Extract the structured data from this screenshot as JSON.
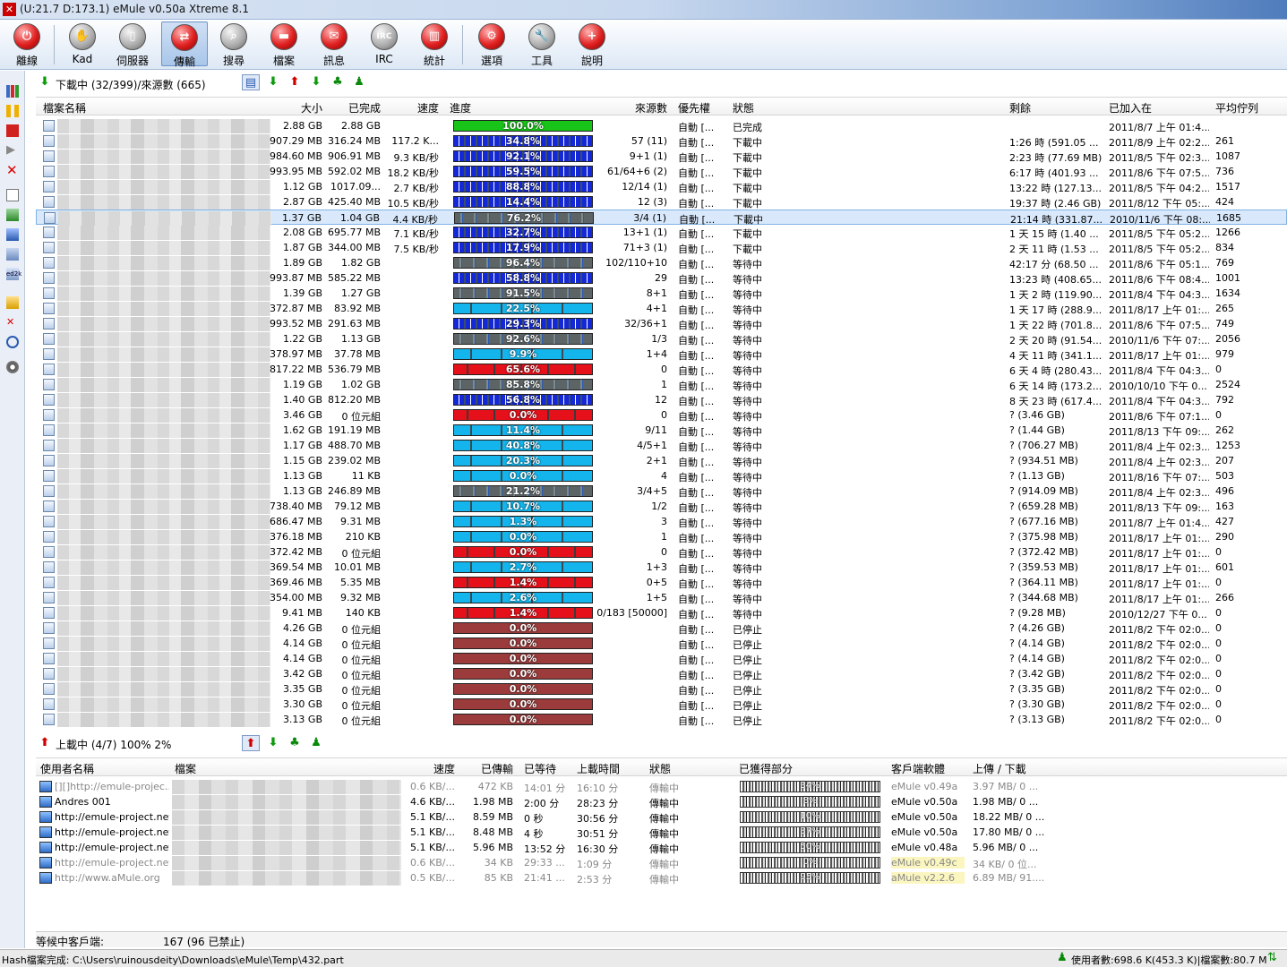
{
  "window": {
    "title": "(U:21.7 D:173.1) eMule v0.50a Xtreme 8.1"
  },
  "toolbar": [
    {
      "label": "離線",
      "icon": "disconnect-icon"
    },
    {
      "label": "Kad",
      "icon": "kad-icon"
    },
    {
      "label": "伺服器",
      "icon": "server-icon"
    },
    {
      "label": "傳輸",
      "icon": "transfer-icon"
    },
    {
      "label": "搜尋",
      "icon": "search-icon"
    },
    {
      "label": "檔案",
      "icon": "shared-files-icon"
    },
    {
      "label": "訊息",
      "icon": "messages-icon"
    },
    {
      "label": "IRC",
      "icon": "irc-icon"
    },
    {
      "label": "統計",
      "icon": "statistics-icon"
    },
    {
      "label": "選項",
      "icon": "options-icon"
    },
    {
      "label": "工具",
      "icon": "tools-icon"
    },
    {
      "label": "說明",
      "icon": "help-icon"
    }
  ],
  "downloads": {
    "title": "下載中 (32/399)/來源數 (665)",
    "columns": [
      "檔案名稱",
      "大小",
      "已完成",
      "速度",
      "進度",
      "來源數",
      "優先權",
      "狀態",
      "剩餘",
      "已加入在",
      "平均佇列"
    ],
    "colors": {
      "blue": "#1428d8",
      "cyan": "#13b5ec",
      "gray": "#5c6466",
      "red": "#e6101a",
      "stopped": "#9c3b3b",
      "green": "#18c418"
    },
    "rows": [
      {
        "size": "2.88 GB",
        "done": "2.88 GB",
        "speed": "",
        "progress": "100.0%",
        "pct": 100,
        "bar": "green",
        "sources": "",
        "priority": "自動 [...",
        "status": "已完成",
        "remaining": "",
        "added": "2011/8/7 上午 01:4...",
        "queue": ""
      },
      {
        "size": "907.29 MB",
        "done": "316.24 MB",
        "speed": "117.2 K...",
        "progress": "34.8%",
        "pct": 34.8,
        "bar": "blue",
        "sources": "57 (11)",
        "priority": "自動 [...",
        "status": "下載中",
        "remaining": "1:26 時 (591.05 ...",
        "added": "2011/8/9 上午 02:2...",
        "queue": "261"
      },
      {
        "size": "984.60 MB",
        "done": "906.91 MB",
        "speed": "9.3 KB/秒",
        "progress": "92.1%",
        "pct": 92.1,
        "bar": "blue",
        "sources": "9+1 (1)",
        "priority": "自動 [...",
        "status": "下載中",
        "remaining": "2:23 時 (77.69 MB)",
        "added": "2011/8/5 下午 02:3...",
        "queue": "1087"
      },
      {
        "size": "993.95 MB",
        "done": "592.02 MB",
        "speed": "18.2 KB/秒",
        "progress": "59.5%",
        "pct": 59.5,
        "bar": "blue",
        "sources": "61/64+6 (2)",
        "priority": "自動 [...",
        "status": "下載中",
        "remaining": "6:17 時 (401.93 ...",
        "added": "2011/8/6 下午 07:5...",
        "queue": "736"
      },
      {
        "size": "1.12 GB",
        "done": "1017.09...",
        "speed": "2.7 KB/秒",
        "progress": "88.8%",
        "pct": 88.8,
        "bar": "blue",
        "sources": "12/14 (1)",
        "priority": "自動 [...",
        "status": "下載中",
        "remaining": "13:22 時 (127.13...",
        "added": "2011/8/5 下午 04:2...",
        "queue": "1517"
      },
      {
        "size": "2.87 GB",
        "done": "425.40 MB",
        "speed": "10.5 KB/秒",
        "progress": "14.4%",
        "pct": 14.4,
        "bar": "blue",
        "sources": "12 (3)",
        "priority": "自動 [...",
        "status": "下載中",
        "remaining": "19:37 時 (2.46 GB)",
        "added": "2011/8/12 下午 05:...",
        "queue": "424"
      },
      {
        "size": "1.37 GB",
        "done": "1.04 GB",
        "speed": "4.4 KB/秒",
        "progress": "76.2%",
        "pct": 76.2,
        "bar": "gray",
        "sources": "3/4 (1)",
        "priority": "自動 [...",
        "status": "下載中",
        "remaining": "21:14 時 (331.87...",
        "added": "2010/11/6 下午 08:...",
        "queue": "1685",
        "selected": true
      },
      {
        "size": "2.08 GB",
        "done": "695.77 MB",
        "speed": "7.1 KB/秒",
        "progress": "32.7%",
        "pct": 32.7,
        "bar": "blue",
        "sources": "13+1 (1)",
        "priority": "自動 [...",
        "status": "下載中",
        "remaining": "1 天 15 時 (1.40 ...",
        "added": "2011/8/5 下午 05:2...",
        "queue": "1266"
      },
      {
        "size": "1.87 GB",
        "done": "344.00 MB",
        "speed": "7.5 KB/秒",
        "progress": "17.9%",
        "pct": 17.9,
        "bar": "blue",
        "sources": "71+3 (1)",
        "priority": "自動 [...",
        "status": "下載中",
        "remaining": "2 天 11 時 (1.53 ...",
        "added": "2011/8/5 下午 05:2...",
        "queue": "834"
      },
      {
        "size": "1.89 GB",
        "done": "1.82 GB",
        "speed": "",
        "progress": "96.4%",
        "pct": 96.4,
        "bar": "gray",
        "sources": "102/110+10",
        "priority": "自動 [...",
        "status": "等待中",
        "remaining": "42:17 分 (68.50 ...",
        "added": "2011/8/6 下午 05:1...",
        "queue": "769"
      },
      {
        "size": "993.87 MB",
        "done": "585.22 MB",
        "speed": "",
        "progress": "58.8%",
        "pct": 58.8,
        "bar": "blue",
        "sources": "29",
        "priority": "自動 [...",
        "status": "等待中",
        "remaining": "13:23 時 (408.65...",
        "added": "2011/8/6 下午 08:4...",
        "queue": "1001"
      },
      {
        "size": "1.39 GB",
        "done": "1.27 GB",
        "speed": "",
        "progress": "91.5%",
        "pct": 91.5,
        "bar": "gray",
        "sources": "8+1",
        "priority": "自動 [...",
        "status": "等待中",
        "remaining": "1 天 2 時 (119.90...",
        "added": "2011/8/4 下午 04:3...",
        "queue": "1634"
      },
      {
        "size": "372.87 MB",
        "done": "83.92 MB",
        "speed": "",
        "progress": "22.5%",
        "pct": 22.5,
        "bar": "cyan",
        "sources": "4+1",
        "priority": "自動 [...",
        "status": "等待中",
        "remaining": "1 天 17 時 (288.9...",
        "added": "2011/8/17 上午 01:...",
        "queue": "265"
      },
      {
        "size": "993.52 MB",
        "done": "291.63 MB",
        "speed": "",
        "progress": "29.3%",
        "pct": 29.3,
        "bar": "blue",
        "sources": "32/36+1",
        "priority": "自動 [...",
        "status": "等待中",
        "remaining": "1 天 22 時 (701.8...",
        "added": "2011/8/6 下午 07:5...",
        "queue": "749"
      },
      {
        "size": "1.22 GB",
        "done": "1.13 GB",
        "speed": "",
        "progress": "92.6%",
        "pct": 92.6,
        "bar": "gray",
        "sources": "1/3",
        "priority": "自動 [...",
        "status": "等待中",
        "remaining": "2 天 20 時 (91.54...",
        "added": "2010/11/6 下午 07:...",
        "queue": "2056"
      },
      {
        "size": "378.97 MB",
        "done": "37.78 MB",
        "speed": "",
        "progress": "9.9%",
        "pct": 9.9,
        "bar": "cyan",
        "sources": "1+4",
        "priority": "自動 [...",
        "status": "等待中",
        "remaining": "4 天 11 時 (341.1...",
        "added": "2011/8/17 上午 01:...",
        "queue": "979"
      },
      {
        "size": "817.22 MB",
        "done": "536.79 MB",
        "speed": "",
        "progress": "65.6%",
        "pct": 65.6,
        "bar": "red",
        "sources": "0",
        "priority": "自動 [...",
        "status": "等待中",
        "remaining": "6 天 4 時 (280.43...",
        "added": "2011/8/4 下午 04:3...",
        "queue": "0"
      },
      {
        "size": "1.19 GB",
        "done": "1.02 GB",
        "speed": "",
        "progress": "85.8%",
        "pct": 85.8,
        "bar": "gray",
        "sources": "1",
        "priority": "自動 [...",
        "status": "等待中",
        "remaining": "6 天 14 時 (173.2...",
        "added": "2010/10/10 下午 0...",
        "queue": "2524"
      },
      {
        "size": "1.40 GB",
        "done": "812.20 MB",
        "speed": "",
        "progress": "56.8%",
        "pct": 56.8,
        "bar": "blue",
        "sources": "12",
        "priority": "自動 [...",
        "status": "等待中",
        "remaining": "8 天 23 時 (617.4...",
        "added": "2011/8/4 下午 04:3...",
        "queue": "792"
      },
      {
        "size": "3.46 GB",
        "done": "0 位元組",
        "speed": "",
        "progress": "0.0%",
        "pct": 0,
        "bar": "red",
        "sources": "0",
        "priority": "自動 [...",
        "status": "等待中",
        "remaining": "? (3.46 GB)",
        "added": "2011/8/6 下午 07:1...",
        "queue": "0"
      },
      {
        "size": "1.62 GB",
        "done": "191.19 MB",
        "speed": "",
        "progress": "11.4%",
        "pct": 11.4,
        "bar": "cyan",
        "sources": "9/11",
        "priority": "自動 [...",
        "status": "等待中",
        "remaining": "? (1.44 GB)",
        "added": "2011/8/13 下午 09:...",
        "queue": "262"
      },
      {
        "size": "1.17 GB",
        "done": "488.70 MB",
        "speed": "",
        "progress": "40.8%",
        "pct": 40.8,
        "bar": "cyan",
        "sources": "4/5+1",
        "priority": "自動 [...",
        "status": "等待中",
        "remaining": "? (706.27 MB)",
        "added": "2011/8/4 上午 02:3...",
        "queue": "1253"
      },
      {
        "size": "1.15 GB",
        "done": "239.02 MB",
        "speed": "",
        "progress": "20.3%",
        "pct": 20.3,
        "bar": "cyan",
        "sources": "2+1",
        "priority": "自動 [...",
        "status": "等待中",
        "remaining": "? (934.51 MB)",
        "added": "2011/8/4 上午 02:3...",
        "queue": "207"
      },
      {
        "size": "1.13 GB",
        "done": "11 KB",
        "speed": "",
        "progress": "0.0%",
        "pct": 0,
        "bar": "cyan",
        "sources": "4",
        "priority": "自動 [...",
        "status": "等待中",
        "remaining": "? (1.13 GB)",
        "added": "2011/8/16 下午 07:...",
        "queue": "503"
      },
      {
        "size": "1.13 GB",
        "done": "246.89 MB",
        "speed": "",
        "progress": "21.2%",
        "pct": 21.2,
        "bar": "gray",
        "sources": "3/4+5",
        "priority": "自動 [...",
        "status": "等待中",
        "remaining": "? (914.09 MB)",
        "added": "2011/8/4 上午 02:3...",
        "queue": "496"
      },
      {
        "size": "738.40 MB",
        "done": "79.12 MB",
        "speed": "",
        "progress": "10.7%",
        "pct": 10.7,
        "bar": "cyan",
        "sources": "1/2",
        "priority": "自動 [...",
        "status": "等待中",
        "remaining": "? (659.28 MB)",
        "added": "2011/8/13 下午 09:...",
        "queue": "163"
      },
      {
        "size": "686.47 MB",
        "done": "9.31 MB",
        "speed": "",
        "progress": "1.3%",
        "pct": 1.3,
        "bar": "cyan",
        "sources": "3",
        "priority": "自動 [...",
        "status": "等待中",
        "remaining": "? (677.16 MB)",
        "added": "2011/8/7 上午 01:4...",
        "queue": "427"
      },
      {
        "size": "376.18 MB",
        "done": "210 KB",
        "speed": "",
        "progress": "0.0%",
        "pct": 0,
        "bar": "cyan",
        "sources": "1",
        "priority": "自動 [...",
        "status": "等待中",
        "remaining": "? (375.98 MB)",
        "added": "2011/8/17 上午 01:...",
        "queue": "290"
      },
      {
        "size": "372.42 MB",
        "done": "0 位元組",
        "speed": "",
        "progress": "0.0%",
        "pct": 0,
        "bar": "red",
        "sources": "0",
        "priority": "自動 [...",
        "status": "等待中",
        "remaining": "? (372.42 MB)",
        "added": "2011/8/17 上午 01:...",
        "queue": "0"
      },
      {
        "size": "369.54 MB",
        "done": "10.01 MB",
        "speed": "",
        "progress": "2.7%",
        "pct": 2.7,
        "bar": "cyan",
        "sources": "1+3",
        "priority": "自動 [...",
        "status": "等待中",
        "remaining": "? (359.53 MB)",
        "added": "2011/8/17 上午 01:...",
        "queue": "601"
      },
      {
        "size": "369.46 MB",
        "done": "5.35 MB",
        "speed": "",
        "progress": "1.4%",
        "pct": 1.4,
        "bar": "red",
        "sources": "0+5",
        "priority": "自動 [...",
        "status": "等待中",
        "remaining": "? (364.11 MB)",
        "added": "2011/8/17 上午 01:...",
        "queue": "0"
      },
      {
        "size": "354.00 MB",
        "done": "9.32 MB",
        "speed": "",
        "progress": "2.6%",
        "pct": 2.6,
        "bar": "cyan",
        "sources": "1+5",
        "priority": "自動 [...",
        "status": "等待中",
        "remaining": "? (344.68 MB)",
        "added": "2011/8/17 上午 01:...",
        "queue": "266"
      },
      {
        "size": "9.41 MB",
        "done": "140 KB",
        "speed": "",
        "progress": "1.4%",
        "pct": 1.4,
        "bar": "red",
        "sources": "0/183 [50000]",
        "priority": "自動 [...",
        "status": "等待中",
        "remaining": "? (9.28 MB)",
        "added": "2010/12/27 下午 0...",
        "queue": "0"
      },
      {
        "size": "4.26 GB",
        "done": "0 位元組",
        "speed": "",
        "progress": "0.0%",
        "pct": 0,
        "bar": "stopped",
        "sources": "",
        "priority": "自動 [...",
        "status": "已停止",
        "remaining": "? (4.26 GB)",
        "added": "2011/8/2 下午 02:0...",
        "queue": "0"
      },
      {
        "size": "4.14 GB",
        "done": "0 位元組",
        "speed": "",
        "progress": "0.0%",
        "pct": 0,
        "bar": "stopped",
        "sources": "",
        "priority": "自動 [...",
        "status": "已停止",
        "remaining": "? (4.14 GB)",
        "added": "2011/8/2 下午 02:0...",
        "queue": "0"
      },
      {
        "size": "4.14 GB",
        "done": "0 位元組",
        "speed": "",
        "progress": "0.0%",
        "pct": 0,
        "bar": "stopped",
        "sources": "",
        "priority": "自動 [...",
        "status": "已停止",
        "remaining": "? (4.14 GB)",
        "added": "2011/8/2 下午 02:0...",
        "queue": "0"
      },
      {
        "size": "3.42 GB",
        "done": "0 位元組",
        "speed": "",
        "progress": "0.0%",
        "pct": 0,
        "bar": "stopped",
        "sources": "",
        "priority": "自動 [...",
        "status": "已停止",
        "remaining": "? (3.42 GB)",
        "added": "2011/8/2 下午 02:0...",
        "queue": "0"
      },
      {
        "size": "3.35 GB",
        "done": "0 位元組",
        "speed": "",
        "progress": "0.0%",
        "pct": 0,
        "bar": "stopped",
        "sources": "",
        "priority": "自動 [...",
        "status": "已停止",
        "remaining": "? (3.35 GB)",
        "added": "2011/8/2 下午 02:0...",
        "queue": "0"
      },
      {
        "size": "3.30 GB",
        "done": "0 位元組",
        "speed": "",
        "progress": "0.0%",
        "pct": 0,
        "bar": "stopped",
        "sources": "",
        "priority": "自動 [...",
        "status": "已停止",
        "remaining": "? (3.30 GB)",
        "added": "2011/8/2 下午 02:0...",
        "queue": "0"
      },
      {
        "size": "3.13 GB",
        "done": "0 位元組",
        "speed": "",
        "progress": "0.0%",
        "pct": 0,
        "bar": "stopped",
        "sources": "",
        "priority": "自動 [...",
        "status": "已停止",
        "remaining": "? (3.13 GB)",
        "added": "2011/8/2 下午 02:0...",
        "queue": "0"
      }
    ]
  },
  "uploads": {
    "title": "上載中 (4/7) 100% 2%",
    "columns": [
      "使用者名稱",
      "檔案",
      "速度",
      "已傳輸",
      "已等待",
      "上載時間",
      "狀態",
      "已獲得部分",
      "客戶端軟體",
      "上傳 / 下載"
    ],
    "rows": [
      {
        "user": "[][]http://emule-projec...",
        "speed": "0.6 KB/...",
        "transferred": "472 KB",
        "waited": "14:01 分",
        "uptime": "16:10 分",
        "status": "傳輸中",
        "parts": "34%",
        "client": "eMule v0.49a",
        "ratio": "3.97 MB/ 0 ...",
        "dim": true
      },
      {
        "user": "Andres 001",
        "speed": "4.6 KB/...",
        "transferred": "1.98 MB",
        "waited": "2:00 分",
        "uptime": "28:23 分",
        "status": "傳輸中",
        "parts": "8%",
        "client": "eMule v0.50a",
        "ratio": "1.98 MB/ 0 ..."
      },
      {
        "user": "http://emule-project.net",
        "speed": "5.1 KB/...",
        "transferred": "8.59 MB",
        "waited": "0 秒",
        "uptime": "30:56 分",
        "status": "傳輸中",
        "parts": "10%",
        "client": "eMule v0.50a",
        "ratio": "18.22 MB/ 0 ..."
      },
      {
        "user": "http://emule-project.net",
        "speed": "5.1 KB/...",
        "transferred": "8.48 MB",
        "waited": "4 秒",
        "uptime": "30:51 分",
        "status": "傳輸中",
        "parts": "37%",
        "client": "eMule v0.50a",
        "ratio": "17.80 MB/ 0 ..."
      },
      {
        "user": "http://emule-project.net",
        "speed": "5.1 KB/...",
        "transferred": "5.96 MB",
        "waited": "13:52 分",
        "uptime": "16:30 分",
        "status": "傳輸中",
        "parts": "50%",
        "client": "eMule v0.48a",
        "ratio": "5.96 MB/ 0 ..."
      },
      {
        "user": "http://emule-project.net",
        "speed": "0.6 KB/...",
        "transferred": "34 KB",
        "waited": "29:33 ...",
        "uptime": "1:09 分",
        "status": "傳輸中",
        "parts": "0%",
        "client": "eMule v0.49c",
        "ratio": "34 KB/ 0 位...",
        "dim": true,
        "highlight": true
      },
      {
        "user": "http://www.aMule.org",
        "speed": "0.5 KB/...",
        "transferred": "85 KB",
        "waited": "21:41 ...",
        "uptime": "2:53 分",
        "status": "傳輸中",
        "parts": "95%",
        "client": "aMule v2.2.6",
        "ratio": "6.89 MB/ 91....",
        "dim": true,
        "highlight": true
      }
    ]
  },
  "waiting": {
    "label": "等候中客戶端:",
    "value": "167 (96 已禁止)"
  },
  "statusbar": {
    "message": "Hash檔案完成: C:\\Users\\ruinousdeity\\Downloads\\eMule\\Temp\\432.part",
    "users": "使用者數:698.6 K(453.3 K)|檔案數:80.7 M"
  }
}
